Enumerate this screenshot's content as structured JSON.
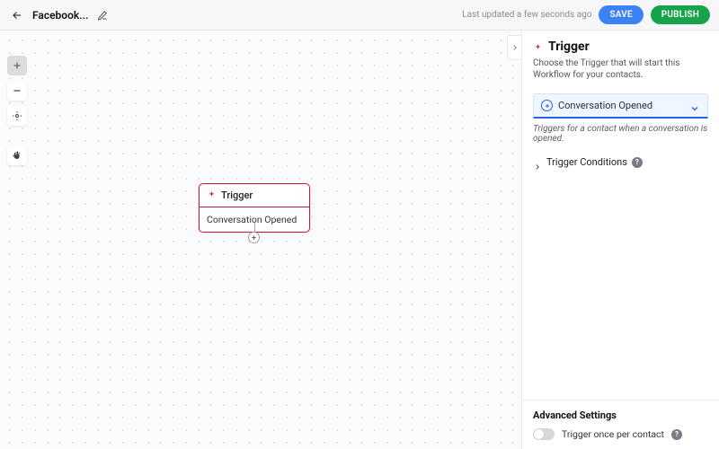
{
  "header": {
    "title": "Facebook...",
    "updated_text": "Last updated a few seconds ago",
    "save_label": "SAVE",
    "publish_label": "PUBLISH"
  },
  "canvas": {
    "node": {
      "title": "Trigger",
      "body": "Conversation Opened"
    }
  },
  "sidebar": {
    "title": "Trigger",
    "description": "Choose the Trigger that will start this Workflow for your contacts.",
    "select_value": "Conversation Opened",
    "helper_text": "Triggers for a contact when a conversation is opened.",
    "conditions_label": "Trigger Conditions",
    "advanced_title": "Advanced Settings",
    "toggle_label": "Trigger once per contact"
  }
}
